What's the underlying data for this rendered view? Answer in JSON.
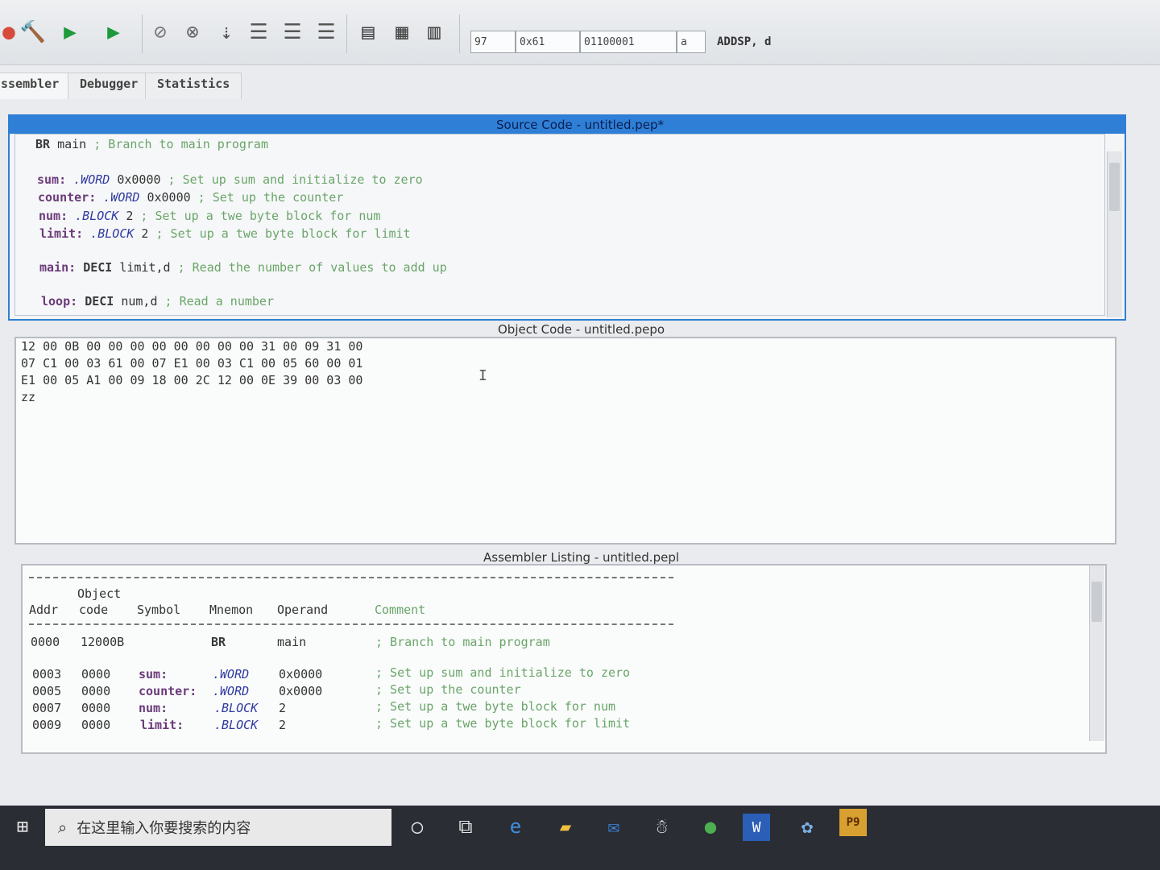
{
  "toolbar": {
    "icons": [
      "build-icon",
      "run-icon",
      "debug-icon",
      "stop-icon",
      "cancel-icon",
      "step-into-icon",
      "step-over-icon",
      "step-return-icon",
      "step-out-icon",
      "layout-icon-1",
      "layout-icon-2",
      "layout-icon-3"
    ]
  },
  "cpu": {
    "decimal": "97",
    "hex": "0x61",
    "binary": "01100001",
    "char": "a",
    "instruction": "ADDSP, d"
  },
  "tabs": [
    {
      "label": "ssembler"
    },
    {
      "label": "Debugger"
    },
    {
      "label": "Statistics"
    }
  ],
  "source": {
    "title": "Source Code - untitled.pep*",
    "lines": [
      {
        "label": "",
        "mnemonic": "BR",
        "args": " main",
        "comment": " ; Branch to main program"
      },
      {
        "label": "sum:",
        "mnemonic": ".WORD",
        "args": " 0x0000",
        "comment": " ; Set up sum and initialize to zero"
      },
      {
        "label": "counter:",
        "mnemonic": ".WORD",
        "args": " 0x0000",
        "comment": " ; Set up the counter"
      },
      {
        "label": "num:",
        "mnemonic": ".BLOCK",
        "args": " 2",
        "comment": " ; Set up a twe byte block for num"
      },
      {
        "label": "limit:",
        "mnemonic": ".BLOCK",
        "args": " 2",
        "comment": " ; Set up a twe byte block for limit"
      },
      {
        "label": "main:",
        "mnemonic": "DECI",
        "args": " limit,d",
        "comment": " ; Read the number of values to add up"
      },
      {
        "label": "loop:",
        "mnemonic": "DECI",
        "args": " num,d",
        "comment": " ; Read a number"
      }
    ]
  },
  "object": {
    "title": "Object Code - untitled.pepo",
    "lines": [
      "12 00 0B 00 00 00 00 00 00 00 00 31 00 09 31 00",
      "07 C1 00 03 61 00 07 E1 00 03 C1 00 05 60 00 01",
      "E1 00 05 A1 00 09 18 00 2C 12 00 0E 39 00 03 00",
      "zz"
    ]
  },
  "listing": {
    "title": "Assembler Listing - untitled.pepl",
    "header_top": "Object",
    "headers": {
      "addr": "Addr",
      "code": "code",
      "symbol": "Symbol",
      "mnemon": "Mnemon",
      "operand": "Operand",
      "comment": "Comment"
    },
    "rows": [
      {
        "addr": "0000",
        "code": "12000B",
        "symbol": "",
        "mnemon": "BR",
        "operand": "main",
        "comment": "; Branch to main program"
      },
      {
        "addr": "0003",
        "code": "0000",
        "symbol": "sum:",
        "mnemon": ".WORD",
        "operand": "0x0000",
        "comment": "; Set up sum and initialize to zero"
      },
      {
        "addr": "0005",
        "code": "0000",
        "symbol": "counter:",
        "mnemon": ".WORD",
        "operand": "0x0000",
        "comment": "; Set up the counter"
      },
      {
        "addr": "0007",
        "code": "0000",
        "symbol": "num:",
        "mnemon": ".BLOCK",
        "operand": "2",
        "comment": "; Set up a twe byte block for num"
      },
      {
        "addr": "0009",
        "code": "0000",
        "symbol": "limit:",
        "mnemon": ".BLOCK",
        "operand": "2",
        "comment": "; Set up a twe byte block for limit"
      }
    ]
  },
  "taskbar": {
    "search_placeholder": "在这里输入你要搜索的内容",
    "icons": [
      "windows-start-icon",
      "cortana-icon",
      "task-view-icon",
      "edge-icon",
      "file-explorer-icon",
      "mail-icon",
      "qq-icon",
      "wechat-icon",
      "word-icon",
      "network-app-icon",
      "pep9-icon"
    ]
  },
  "colors": {
    "title_bar": "#2f7fd6",
    "comment": "#6aa56a",
    "directive": "#2f3aa0"
  }
}
